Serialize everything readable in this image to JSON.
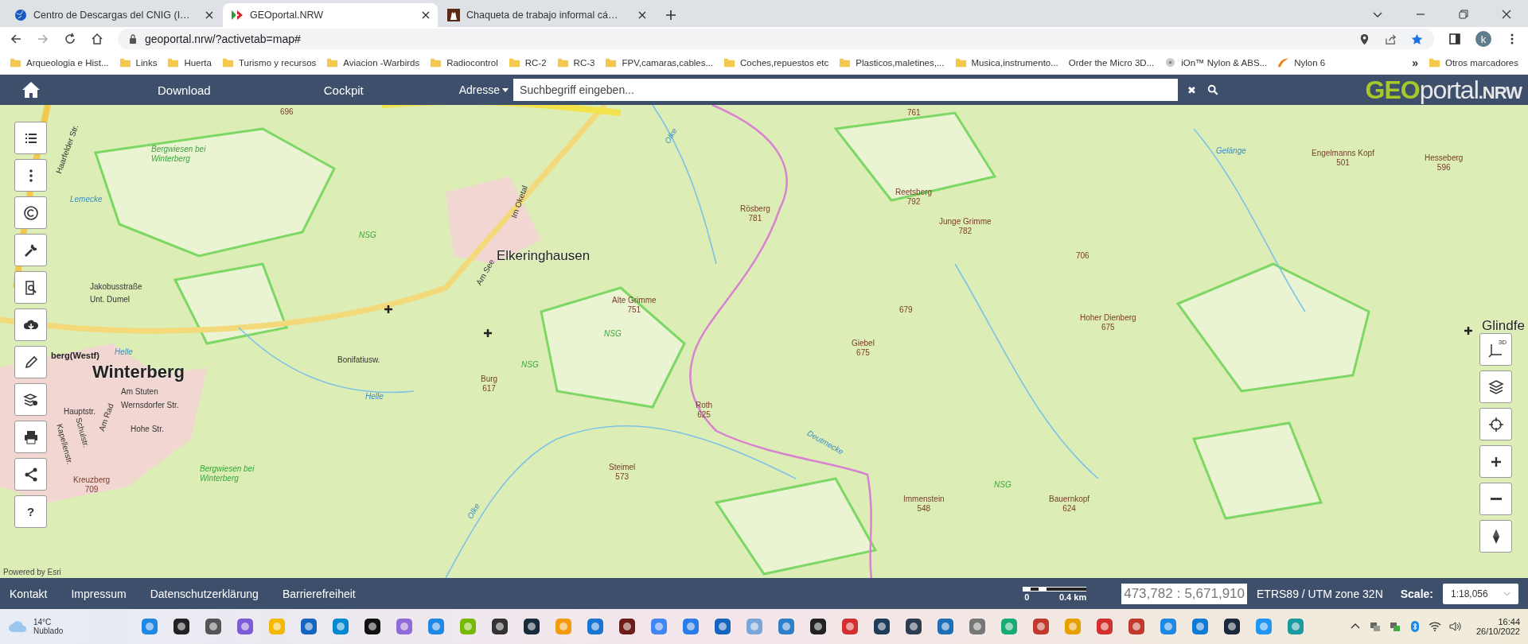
{
  "browser": {
    "tabs": [
      {
        "title": "Centro de Descargas del CNIG (I…",
        "kind": "globe",
        "selected": false
      },
      {
        "title": "GEOportal.NRW",
        "kind": "nrw",
        "selected": true
      },
      {
        "title": "Chaqueta de trabajo informal cá…",
        "kind": "jacket",
        "selected": false
      }
    ],
    "url": "geoportal.nrw/?activetab=map#",
    "profile_initial": "k",
    "bookmarks": [
      {
        "label": "Arqueologia e Hist...",
        "kind": "folder"
      },
      {
        "label": "Links",
        "kind": "folder"
      },
      {
        "label": "Huerta",
        "kind": "folder"
      },
      {
        "label": "Turismo y recursos",
        "kind": "folder"
      },
      {
        "label": "Aviacion -Warbirds",
        "kind": "folder"
      },
      {
        "label": "Radiocontrol",
        "kind": "folder"
      },
      {
        "label": "RC-2",
        "kind": "folder"
      },
      {
        "label": "RC-3",
        "kind": "folder"
      },
      {
        "label": "FPV,camaras,cables...",
        "kind": "folder"
      },
      {
        "label": "Coches,repuestos etc",
        "kind": "folder"
      },
      {
        "label": "Plasticos,maletines,...",
        "kind": "folder"
      },
      {
        "label": "Musica,instrumento...",
        "kind": "folder"
      },
      {
        "label": "Order the Micro 3D...",
        "kind": "none"
      },
      {
        "label": "iOn™ Nylon & ABS...",
        "kind": "spool"
      },
      {
        "label": "Nylon 6",
        "kind": "swoosh"
      }
    ],
    "more": "»",
    "other_bookmarks": "Otros marcadores"
  },
  "header": {
    "nav": [
      "Download",
      "Cockpit"
    ],
    "search_scope": "Adresse",
    "search_placeholder": "Suchbegriff eingeben...",
    "clear": "✖",
    "logo": {
      "part_1": "GEO",
      "part_2": "portal",
      "part_3": ".NRW"
    }
  },
  "left_tools": [
    {
      "kind": "list"
    },
    {
      "kind": "dots"
    },
    {
      "kind": "copyright"
    },
    {
      "kind": "wrench"
    },
    {
      "kind": "search-doc"
    },
    {
      "kind": "download"
    },
    {
      "kind": "pencil"
    },
    {
      "kind": "layers-gear"
    },
    {
      "kind": "print"
    },
    {
      "kind": "share"
    },
    {
      "kind": "help",
      "label": "?"
    }
  ],
  "right_tools": [
    {
      "kind": "perspective",
      "label": "3D"
    },
    {
      "kind": "layers"
    },
    {
      "kind": "locate"
    },
    {
      "kind": "zoom-in"
    },
    {
      "kind": "zoom-out"
    },
    {
      "kind": "compass"
    }
  ],
  "map": {
    "labels": [
      {
        "kind": "town",
        "text": "Winterberg"
      },
      {
        "kind": "town",
        "text": "Elkeringhausen"
      },
      {
        "kind": "town",
        "text": "Glindfe"
      },
      {
        "kind": "peak",
        "text": "Rösberg",
        "elevation": "781"
      },
      {
        "kind": "peak",
        "text": "Reetsberg",
        "elevation": "792"
      },
      {
        "kind": "peak",
        "text": "Junge Grimme",
        "elevation": "782"
      },
      {
        "kind": "peak",
        "text": "Alte Grimme",
        "elevation": "751"
      },
      {
        "kind": "peak",
        "text": "Giebel",
        "elevation": "675"
      },
      {
        "kind": "peak",
        "elevation": "679"
      },
      {
        "kind": "peak",
        "elevation": "706"
      },
      {
        "kind": "peak",
        "text": "Hoher Dienberg",
        "elevation": "675"
      },
      {
        "kind": "peak",
        "text": "Engelmanns Kopf",
        "elevation": "501"
      },
      {
        "kind": "peak",
        "text": "Hesseberg",
        "elevation": "596"
      },
      {
        "kind": "peak",
        "elevation": "696"
      },
      {
        "kind": "peak",
        "text": "Burg",
        "elevation": "617"
      },
      {
        "kind": "peak",
        "text": "Roth",
        "elevation": "625"
      },
      {
        "kind": "peak",
        "text": "Steimel",
        "elevation": "573"
      },
      {
        "kind": "peak",
        "text": "Immenstein",
        "elevation": "548"
      },
      {
        "kind": "peak",
        "text": "Bauernkopf",
        "elevation": "624"
      },
      {
        "kind": "peak",
        "text": "Kreuzberg",
        "elevation": "709"
      },
      {
        "kind": "area",
        "text": "Bergwiesen bei Winterberg"
      },
      {
        "kind": "area",
        "text": "Bergwiesen bei Winterberg"
      },
      {
        "kind": "area",
        "text": "NSG"
      },
      {
        "kind": "area",
        "text": "NSG"
      },
      {
        "kind": "area",
        "text": "NSG"
      },
      {
        "kind": "area",
        "text": "NSG"
      },
      {
        "kind": "water",
        "text": "Gelänge"
      },
      {
        "kind": "water",
        "text": "Deutmecke"
      },
      {
        "kind": "water",
        "text": "Helle"
      },
      {
        "kind": "water",
        "text": "Helle"
      },
      {
        "kind": "water",
        "text": "Lemecke"
      },
      {
        "kind": "water",
        "text": "Olke"
      },
      {
        "kind": "water",
        "text": "Olke"
      },
      {
        "kind": "street",
        "text": "Am Stuten"
      },
      {
        "kind": "street",
        "text": "Hauptstr."
      },
      {
        "kind": "street",
        "text": "Wernsdorfer Str."
      },
      {
        "kind": "street",
        "text": "Hohe Str."
      },
      {
        "kind": "street",
        "text": "Am Rad"
      },
      {
        "kind": "street",
        "text": "Schulstr."
      },
      {
        "kind": "street",
        "text": "Kapellenstr."
      },
      {
        "kind": "street",
        "text": "Bonifatiusw."
      },
      {
        "kind": "street",
        "text": "Im Oketal"
      },
      {
        "kind": "street",
        "text": "Jakobusstraße"
      },
      {
        "kind": "street",
        "text": "Unt. Dumel"
      },
      {
        "kind": "street",
        "text": "Am See"
      },
      {
        "kind": "street",
        "text": "Haarfelder Str."
      },
      {
        "kind": "station",
        "text": "berg(Westf)"
      },
      {
        "kind": "peak",
        "elevation": "761"
      }
    ],
    "attribution": "Powered by Esri"
  },
  "footer": {
    "links": [
      "Kontakt",
      "Impressum",
      "Datenschutzerklärung",
      "Barrierefreiheit"
    ],
    "scale_bar": {
      "start": "0",
      "end": "0.4 km"
    },
    "easting": "473,782",
    "separator": ":",
    "northing": "5,671,910",
    "crs": "ETRS89 / UTM zone 32N",
    "scale_label": "Scale:",
    "scale_value": "1:18,056"
  },
  "taskbar": {
    "temperature": "14°C",
    "weather": "Nublado",
    "time": "16:44",
    "date": "26/10/2022"
  }
}
